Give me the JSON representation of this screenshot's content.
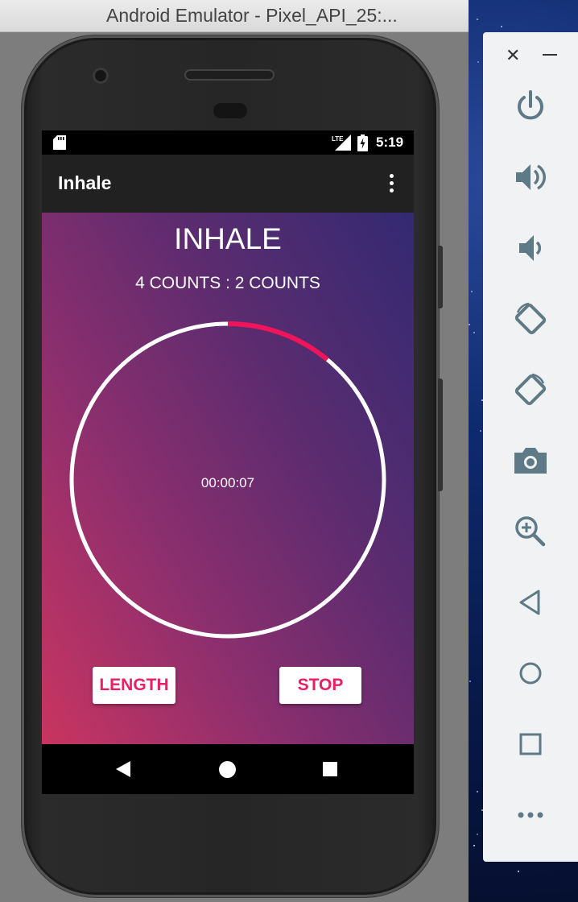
{
  "window": {
    "title": "Android Emulator - Pixel_API_25:..."
  },
  "status_bar": {
    "time": "5:19",
    "network": "LTE"
  },
  "toolbar": {
    "title": "Inhale"
  },
  "exercise": {
    "phase": "INHALE",
    "counts": "4 COUNTS : 2 COUNTS",
    "timer": "00:00:07",
    "progress_fraction": 0.11
  },
  "buttons": {
    "length_label": "LENGTH",
    "stop_label": "STOP"
  },
  "colors": {
    "accent": "#e91e63",
    "toolbar": "#212121",
    "gradient_start": "#c93560",
    "gradient_end": "#332a72",
    "ring": "#ffffff",
    "ring_progress": "#f0145a"
  },
  "emulator_panel": {
    "controls": [
      "close-icon",
      "minimize-icon",
      "power-icon",
      "volume-up-icon",
      "volume-down-icon",
      "rotate-left-icon",
      "rotate-right-icon",
      "camera-icon",
      "zoom-icon",
      "back-icon",
      "home-icon",
      "overview-icon",
      "more-icon"
    ]
  }
}
